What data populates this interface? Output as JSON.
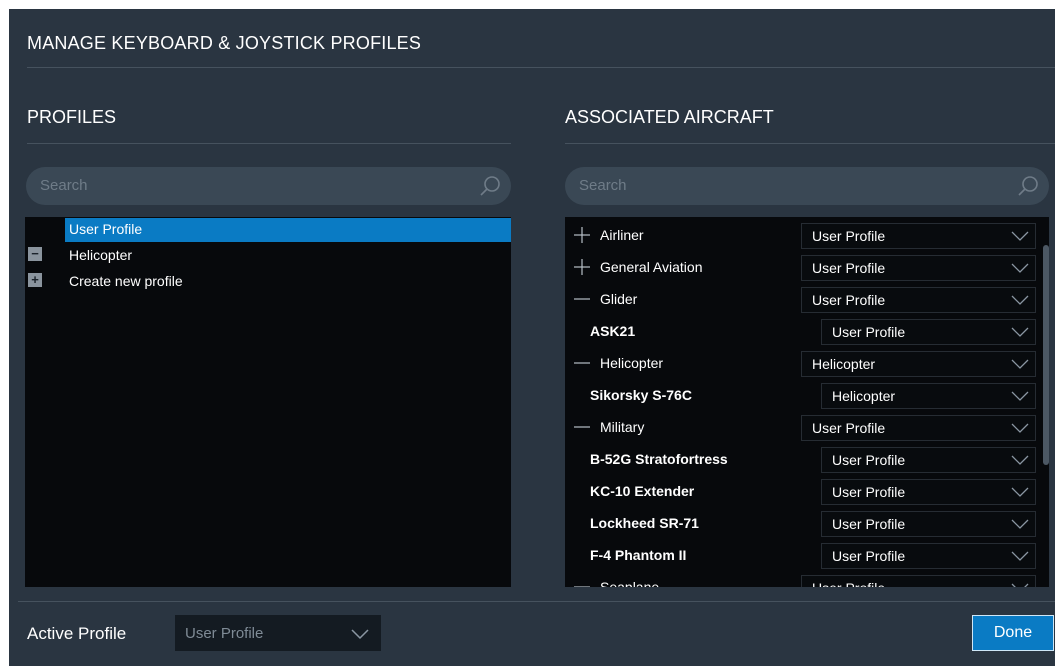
{
  "dialog": {
    "title": "MANAGE KEYBOARD & JOYSTICK PROFILES"
  },
  "profiles": {
    "heading": "PROFILES",
    "search_placeholder": "Search",
    "items": [
      {
        "label": "User Profile",
        "selected": true,
        "control": "none"
      },
      {
        "label": "Helicopter",
        "selected": false,
        "control": "minus"
      },
      {
        "label": "Create new profile",
        "selected": false,
        "control": "plus"
      }
    ]
  },
  "aircraft": {
    "heading": "ASSOCIATED AIRCRAFT",
    "search_placeholder": "Search",
    "rows": [
      {
        "name": "Airliner",
        "kind": "category",
        "expander": "plus",
        "profile": "User Profile"
      },
      {
        "name": "General Aviation",
        "kind": "category",
        "expander": "plus",
        "profile": "User Profile"
      },
      {
        "name": "Glider",
        "kind": "category",
        "expander": "minus",
        "profile": "User Profile"
      },
      {
        "name": "ASK21",
        "kind": "item",
        "profile": "User Profile"
      },
      {
        "name": "Helicopter",
        "kind": "category",
        "expander": "minus",
        "profile": "Helicopter"
      },
      {
        "name": "Sikorsky S-76C",
        "kind": "item",
        "profile": "Helicopter"
      },
      {
        "name": "Military",
        "kind": "category",
        "expander": "minus",
        "profile": "User Profile"
      },
      {
        "name": "B-52G Stratofortress",
        "kind": "item",
        "profile": "User Profile"
      },
      {
        "name": "KC-10 Extender",
        "kind": "item",
        "profile": "User Profile"
      },
      {
        "name": "Lockheed SR-71",
        "kind": "item",
        "profile": "User Profile"
      },
      {
        "name": "F-4 Phantom II",
        "kind": "item",
        "profile": "User Profile"
      },
      {
        "name": "Seaplane",
        "kind": "category",
        "expander": "minus",
        "profile": "User Profile"
      }
    ]
  },
  "footer": {
    "active_profile_label": "Active Profile",
    "active_profile_value": "User Profile",
    "done_label": "Done"
  },
  "colors": {
    "dialog_bg": "#2a3541",
    "list_bg": "#07090c",
    "accent": "#0a7bc4",
    "search_bg": "#3a4855"
  },
  "icons": {
    "search": "magnifier-icon",
    "dropdown": "chevron-down-icon",
    "expand": "plus-icon",
    "collapse": "minus-icon"
  }
}
